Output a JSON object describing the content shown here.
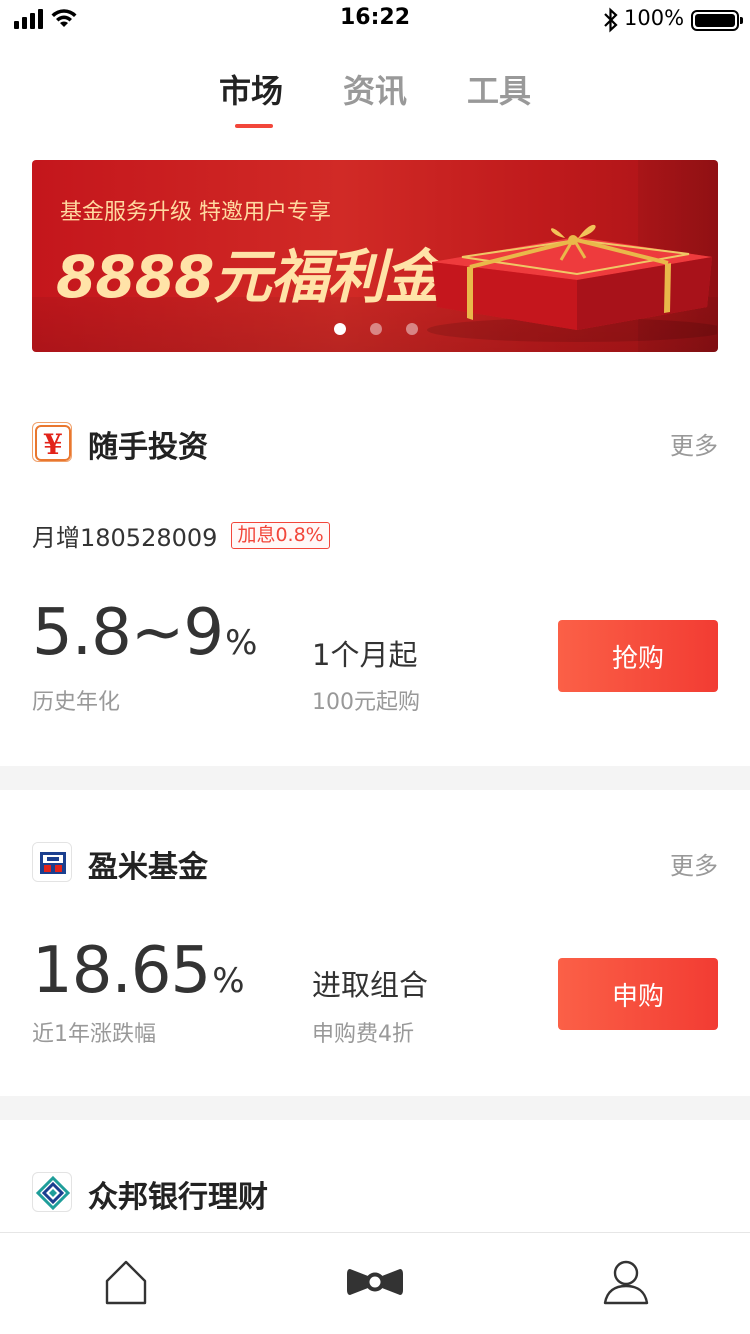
{
  "status_bar": {
    "time": "16:22",
    "battery": "100%"
  },
  "top_tabs": [
    {
      "label": "市场",
      "active": true
    },
    {
      "label": "资讯",
      "active": false
    },
    {
      "label": "工具",
      "active": false
    }
  ],
  "banner": {
    "subtitle": "基金服务升级 特邀用户专享",
    "title": "8888元福利金",
    "dots": 3,
    "active_dot": 0
  },
  "sections": [
    {
      "name": "随手投资",
      "more": "更多",
      "logo_glyph": "¥",
      "tag": "月增180528009",
      "badge": "加息0.8%",
      "rate": "5.8~9",
      "rate_unit": "%",
      "rate_label": "历史年化",
      "term": "1个月起",
      "term_sub": "100元起购",
      "button": "抢购"
    },
    {
      "name": "盈米基金",
      "more": "更多",
      "rate": "18.65",
      "rate_unit": "%",
      "rate_label": "近1年涨跌幅",
      "term": "进取组合",
      "term_sub": "申购费4折",
      "button": "申购"
    },
    {
      "name": "众邦银行理财"
    }
  ],
  "bottom_nav": [
    {
      "icon": "home-icon",
      "active": false
    },
    {
      "icon": "bowtie-icon",
      "active": true
    },
    {
      "icon": "user-icon",
      "active": false
    }
  ],
  "colors": {
    "accent": "#f2463a",
    "banner": "#c4161c",
    "banner_text": "#ffe3a8"
  }
}
